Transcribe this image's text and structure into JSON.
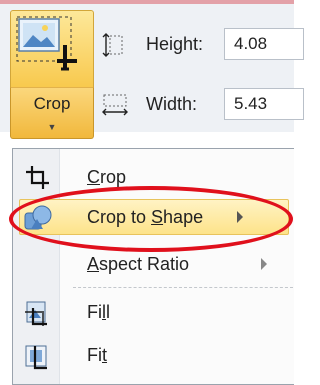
{
  "ribbon": {
    "crop_button": {
      "label": "Crop",
      "icon": "crop-picture-icon",
      "dropdown_icon": "chevron-down-icon",
      "arrow_glyph": "▼"
    },
    "size": {
      "height_label": "Height:",
      "height_value": "4.08",
      "width_label": "Width:",
      "width_value": "5.43",
      "height_icon": "height-icon",
      "width_icon": "width-icon"
    }
  },
  "menu": {
    "items": [
      {
        "label_pre": "",
        "label_u": "C",
        "label_post": "rop",
        "icon": "crop-icon",
        "has_submenu": false
      },
      {
        "label_pre": "Crop to ",
        "label_u": "S",
        "label_post": "hape",
        "icon": "shape-icon",
        "has_submenu": true,
        "highlighted": true
      },
      {
        "label_pre": "",
        "label_u": "A",
        "label_post": "spect Ratio",
        "icon": "",
        "has_submenu": true
      },
      {
        "label_pre": "Fi",
        "label_u": "l",
        "label_post": "l",
        "icon": "fill-icon",
        "has_submenu": false
      },
      {
        "label_pre": "Fi",
        "label_u": "t",
        "label_post": "",
        "icon": "fit-icon",
        "has_submenu": false
      }
    ]
  },
  "colors": {
    "highlight": "#fde38a",
    "annotation_ellipse": "#e0101c",
    "top_border": "#e3a1a8"
  }
}
